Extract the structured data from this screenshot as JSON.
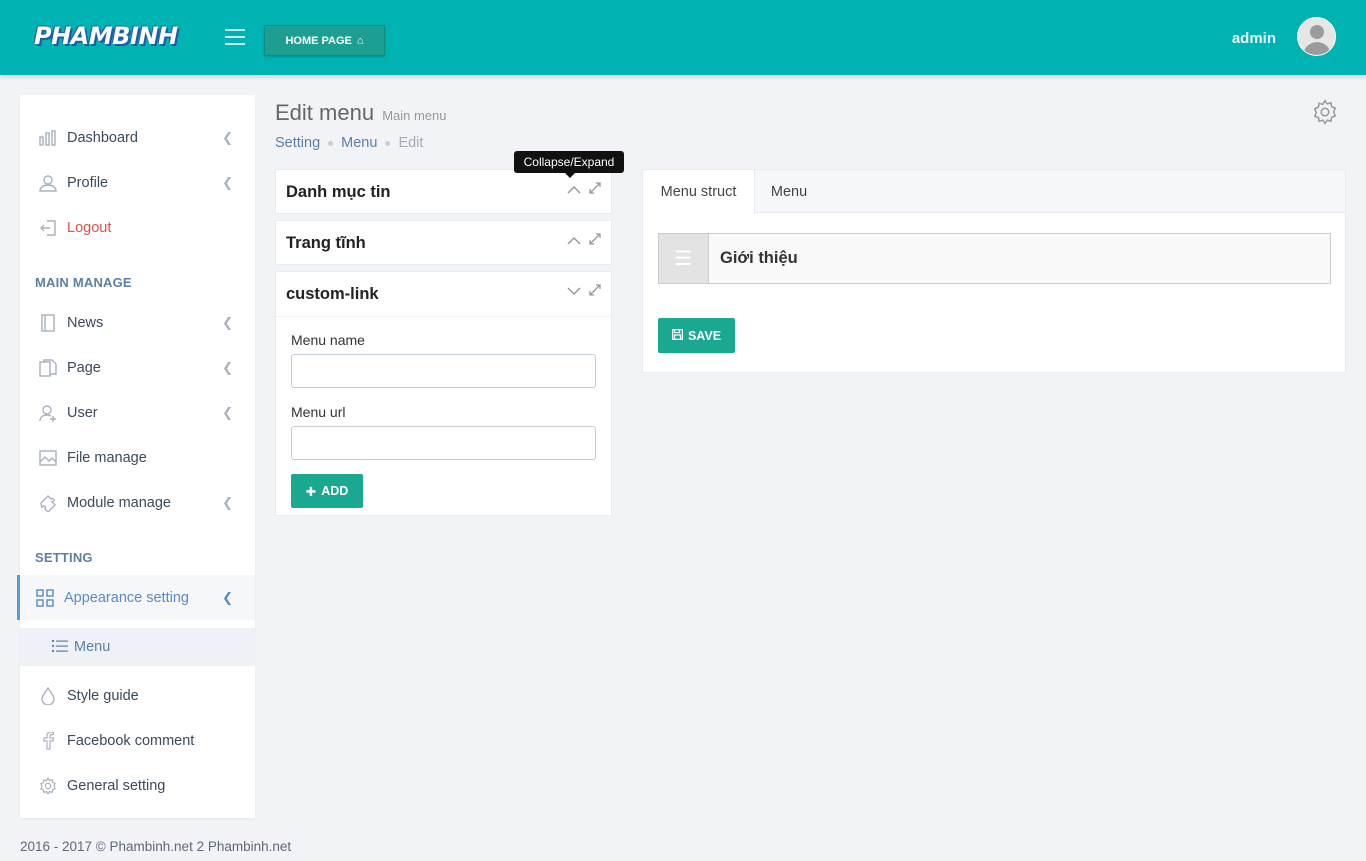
{
  "header": {
    "logo": "PHAMBINH",
    "home_button": "HOME PAGE",
    "user_name": "admin"
  },
  "sidebar": {
    "items_top": [
      {
        "label": "Dashboard",
        "icon": "bar-chart-icon"
      },
      {
        "label": "Profile",
        "icon": "user-icon"
      },
      {
        "label": "Logout",
        "icon": "logout-icon"
      }
    ],
    "section_main": "MAIN MANAGE",
    "items_main": [
      {
        "label": "News",
        "icon": "notebook-icon"
      },
      {
        "label": "Page",
        "icon": "docs-icon"
      },
      {
        "label": "User",
        "icon": "user-follow-icon"
      },
      {
        "label": "File manage",
        "icon": "picture-icon"
      },
      {
        "label": "Module manage",
        "icon": "puzzle-icon"
      }
    ],
    "section_setting": "SETTING",
    "appearance": "Appearance setting",
    "appearance_sub": "Menu",
    "items_setting": [
      {
        "label": "Style guide",
        "icon": "drop-icon"
      },
      {
        "label": "Facebook comment",
        "icon": "facebook-icon"
      },
      {
        "label": "General setting",
        "icon": "gear-icon"
      }
    ]
  },
  "page": {
    "title": "Edit menu",
    "subtitle": "Main menu",
    "breadcrumb": [
      "Setting",
      "Menu",
      "Edit"
    ]
  },
  "panels": {
    "tooltip": "Collapse/Expand",
    "danh_muc": "Danh mục tin",
    "trang_tinh": "Trang tĩnh",
    "custom_link": "custom-link",
    "menu_name_label": "Menu name",
    "menu_name_value": "",
    "menu_url_label": "Menu url",
    "menu_url_value": "",
    "add_button": "ADD"
  },
  "right": {
    "tabs": [
      "Menu struct",
      "Menu"
    ],
    "menu_item": "Giới thiệu",
    "save_button": "SAVE"
  },
  "footer": "2016 - 2017 © Phambinh.net 2 Phambinh.net",
  "colors": {
    "header": "#00b3b3",
    "accent_button": "#1ba891",
    "link": "#5b7fa6",
    "logout": "#d9534f"
  }
}
